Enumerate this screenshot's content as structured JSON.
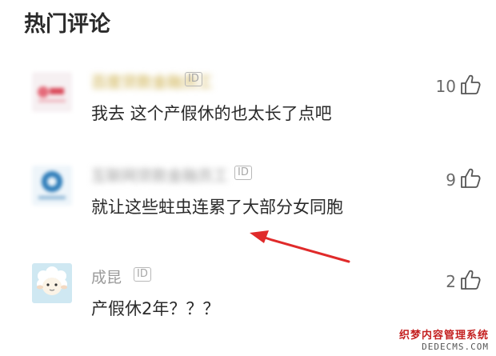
{
  "section": {
    "title": "热门评论"
  },
  "comments": [
    {
      "username": "百度贷款金融员工",
      "badge": "ID",
      "text": "我去 这个产假休的也太长了点吧",
      "likes": "10",
      "avatar_icon": "blurred-brand-avatar-icon"
    },
    {
      "username": "互联网贷款金融员工",
      "badge": "ID",
      "text": "就让这些蛀虫连累了大部分女同胞",
      "likes": "9",
      "avatar_icon": "blurred-finance-logo-avatar-icon"
    },
    {
      "username": "成昆",
      "badge": "ID",
      "text": "产假休2年？？？",
      "likes": "2",
      "avatar_icon": "sheep-cartoon-avatar-icon"
    }
  ],
  "watermark": {
    "line1": "织梦内容管理系统",
    "line2": "DEDECMS.COM"
  },
  "colors": {
    "arrow": "#e02a2a",
    "username": "#9a9a9a",
    "text": "#2a2a2a"
  }
}
